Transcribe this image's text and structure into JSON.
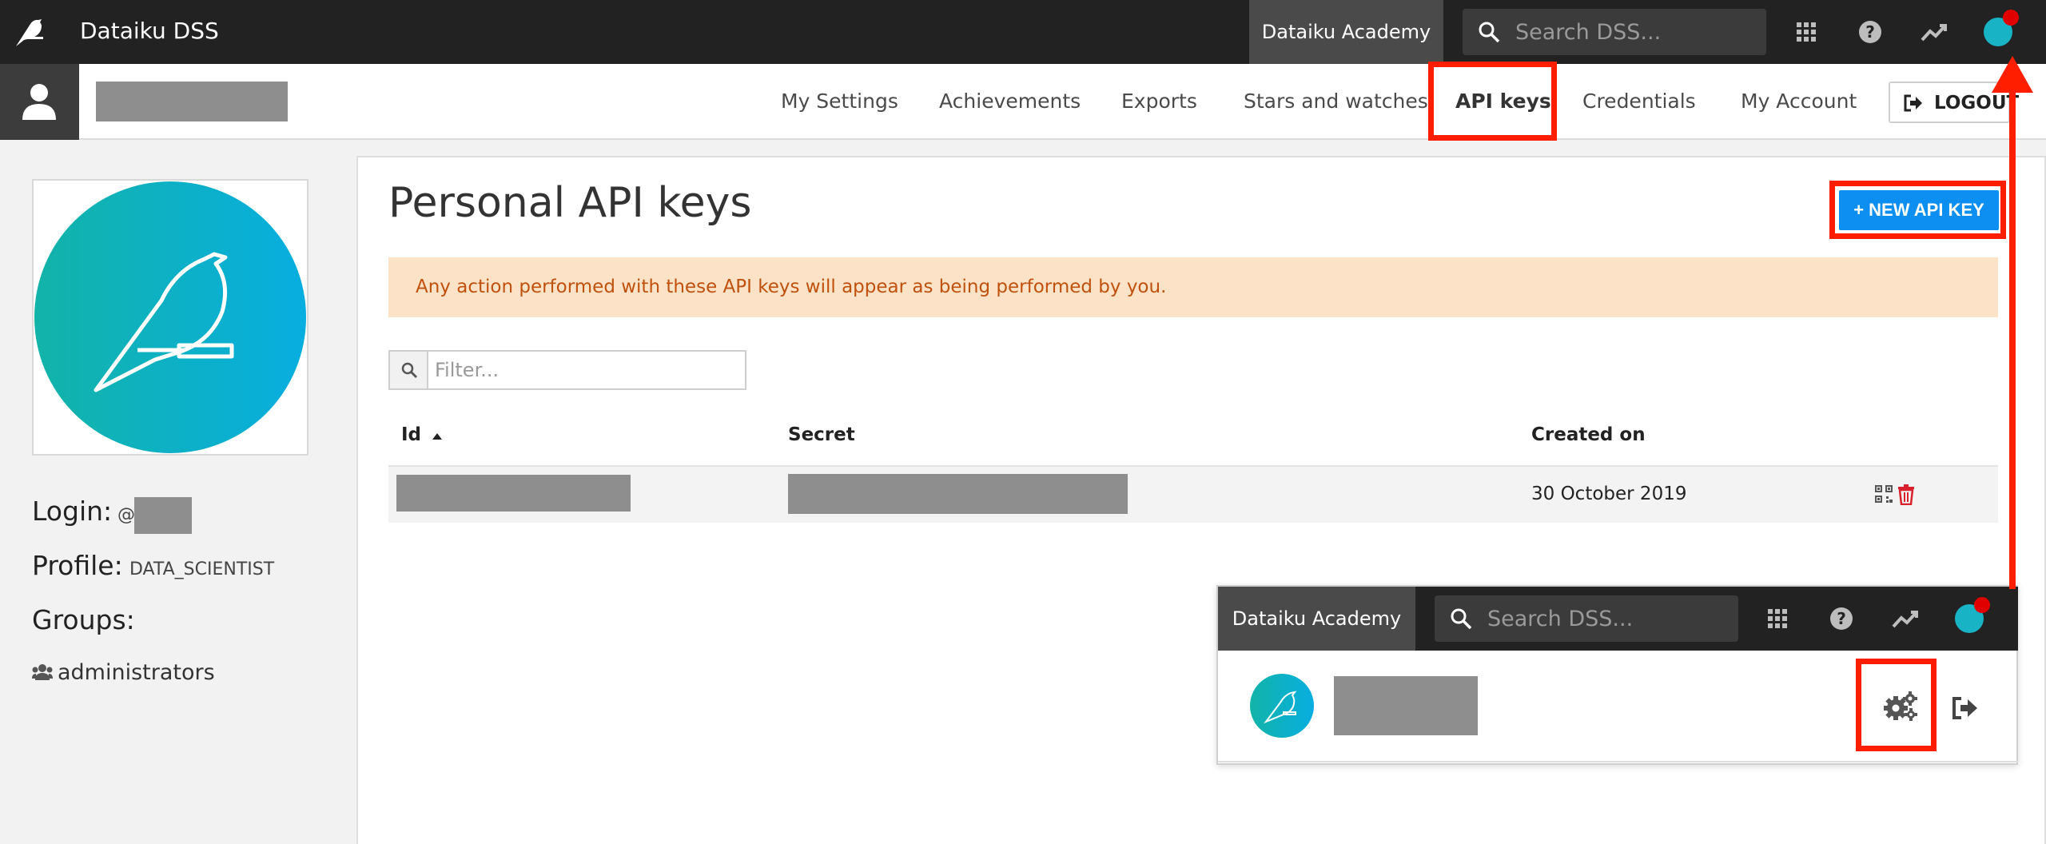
{
  "app": {
    "brand_name": "Dataiku DSS",
    "academy_tab": "Dataiku Academy",
    "search_placeholder": "Search DSS..."
  },
  "topbar_icons": [
    "apps-grid-icon",
    "help-icon",
    "activity-trend-icon"
  ],
  "subnav": {
    "links": [
      {
        "label": "My Settings"
      },
      {
        "label": "Achievements"
      },
      {
        "label": "Exports"
      },
      {
        "label": "Stars and watches"
      },
      {
        "label": "API keys",
        "active": true
      },
      {
        "label": "Credentials"
      },
      {
        "label": "My Account"
      }
    ],
    "logout_label": "LOGOUT"
  },
  "profile": {
    "login_label": "Login:",
    "login_prefix": "@",
    "profile_label": "Profile:",
    "profile_value": "DATA_SCIENTIST",
    "groups_label": "Groups:",
    "groups": [
      "administrators"
    ]
  },
  "main": {
    "title": "Personal API keys",
    "new_key_button": "+ NEW API KEY",
    "warning": "Any action performed with these API keys will appear as being performed by you.",
    "filter_placeholder": "Filter...",
    "columns": {
      "id": "Id",
      "secret": "Secret",
      "created_on": "Created on"
    },
    "rows": [
      {
        "created_on": "30 October 2019"
      }
    ]
  },
  "inset": {
    "academy_tab": "Dataiku Academy",
    "search_placeholder": "Search DSS..."
  },
  "colors": {
    "topbar": "#222222",
    "accent_blue": "#0d8ff2",
    "warning_bg": "#fce3c8",
    "warning_text": "#c0510c",
    "annotation_red": "#ff1f00",
    "avatar_teal": "#18b3c4"
  }
}
